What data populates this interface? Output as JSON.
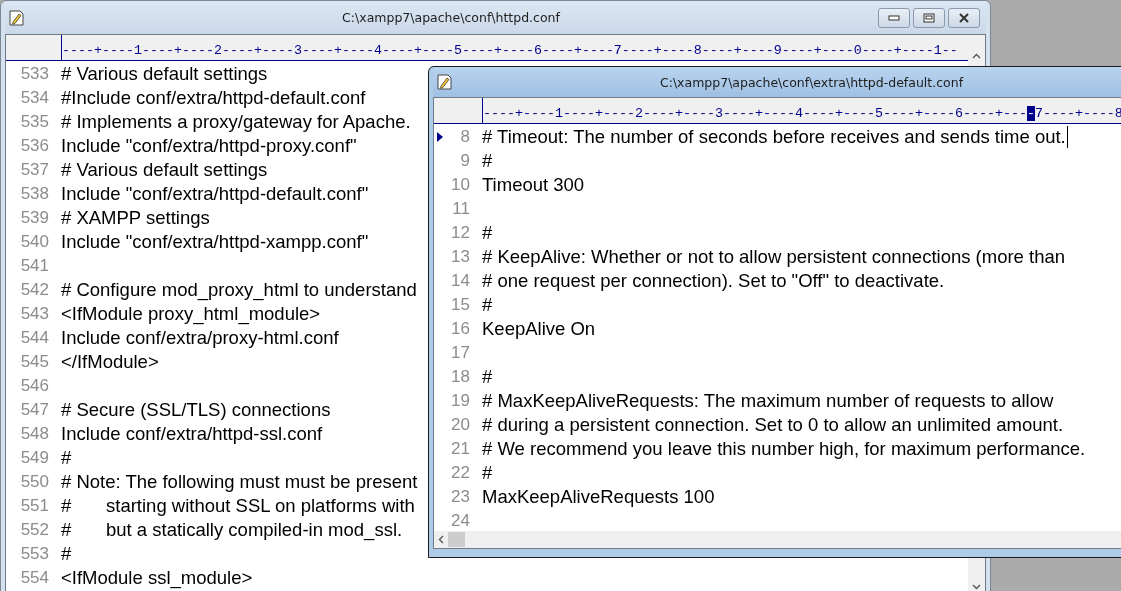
{
  "back_window": {
    "title": "C:\\xampp7\\apache\\conf\\httpd.conf",
    "active": false,
    "ruler": [
      {
        "text": "----+----1----+----2----+----3----+----4----+----5----+----6----+----7----+----8----+----9----+----0----+----1--",
        "marked": false
      }
    ],
    "lines": [
      {
        "number": "533",
        "text": "# Various default settings"
      },
      {
        "number": "534",
        "text": "#Include conf/extra/httpd-default.conf"
      },
      {
        "number": "535",
        "text": "# Implements a proxy/gateway for Apache."
      },
      {
        "number": "536",
        "text": "Include \"conf/extra/httpd-proxy.conf\""
      },
      {
        "number": "537",
        "text": "# Various default settings"
      },
      {
        "number": "538",
        "text": "Include \"conf/extra/httpd-default.conf\""
      },
      {
        "number": "539",
        "text": "# XAMPP settings"
      },
      {
        "number": "540",
        "text": "Include \"conf/extra/httpd-xampp.conf\""
      },
      {
        "number": "541"
      },
      {
        "number": "542",
        "text": "# Configure mod_proxy_html to understand"
      },
      {
        "number": "543",
        "text": "<IfModule proxy_html_module>"
      },
      {
        "number": "544",
        "text": "Include conf/extra/proxy-html.conf"
      },
      {
        "number": "545",
        "text": "</IfModule>"
      },
      {
        "number": "546"
      },
      {
        "number": "547",
        "text": "# Secure (SSL/TLS) connections"
      },
      {
        "number": "548",
        "text": "Include conf/extra/httpd-ssl.conf"
      },
      {
        "number": "549",
        "text": "#"
      },
      {
        "number": "550",
        "text": "# Note: The following must must be present"
      },
      {
        "number": "551",
        "text": "#\tstarting without SSL on platforms with"
      },
      {
        "number": "552",
        "text": "#\tbut a statically compiled-in mod_ssl."
      },
      {
        "number": "553",
        "text": "#"
      },
      {
        "number": "554",
        "text": "<IfModule ssl_module>"
      }
    ]
  },
  "front_window": {
    "title": "C:\\xampp7\\apache\\conf\\extra\\httpd-default.conf",
    "active": true,
    "ruler": [
      {
        "text": "----+----1----+----2----+----3----+----4----+----5----+----6----+---",
        "marked": false
      },
      {
        "text": "-",
        "marked": true
      },
      {
        "text": "7----+----8",
        "marked": false
      }
    ],
    "lines": [
      {
        "number": "8",
        "text": "# Timeout: The number of seconds before receives and sends time out.",
        "current": true
      },
      {
        "number": "9",
        "text": "#",
        "current": false
      },
      {
        "number": "10",
        "text": "Timeout 300",
        "current": false
      },
      {
        "number": "11",
        "current": false
      },
      {
        "number": "12",
        "text": "#",
        "current": false
      },
      {
        "number": "13",
        "text": "# KeepAlive: Whether or not to allow persistent connections (more than",
        "current": false
      },
      {
        "number": "14",
        "text": "# one request per connection). Set to \"Off\" to deactivate.",
        "current": false
      },
      {
        "number": "15",
        "text": "#",
        "current": false
      },
      {
        "number": "16",
        "text": "KeepAlive On",
        "current": false
      },
      {
        "number": "17",
        "current": false
      },
      {
        "number": "18",
        "text": "#",
        "current": false
      },
      {
        "number": "19",
        "text": "# MaxKeepAliveRequests: The maximum number of requests to allow",
        "current": false
      },
      {
        "number": "20",
        "text": "# during a persistent connection. Set to 0 to allow an unlimited amount.",
        "current": false
      },
      {
        "number": "21",
        "text": "# We recommend you leave this number high, for maximum performance.",
        "current": false
      },
      {
        "number": "22",
        "text": "#",
        "current": false
      },
      {
        "number": "23",
        "text": "MaxKeepAliveRequests 100",
        "current": false
      },
      {
        "number": "24",
        "current": false
      }
    ]
  }
}
